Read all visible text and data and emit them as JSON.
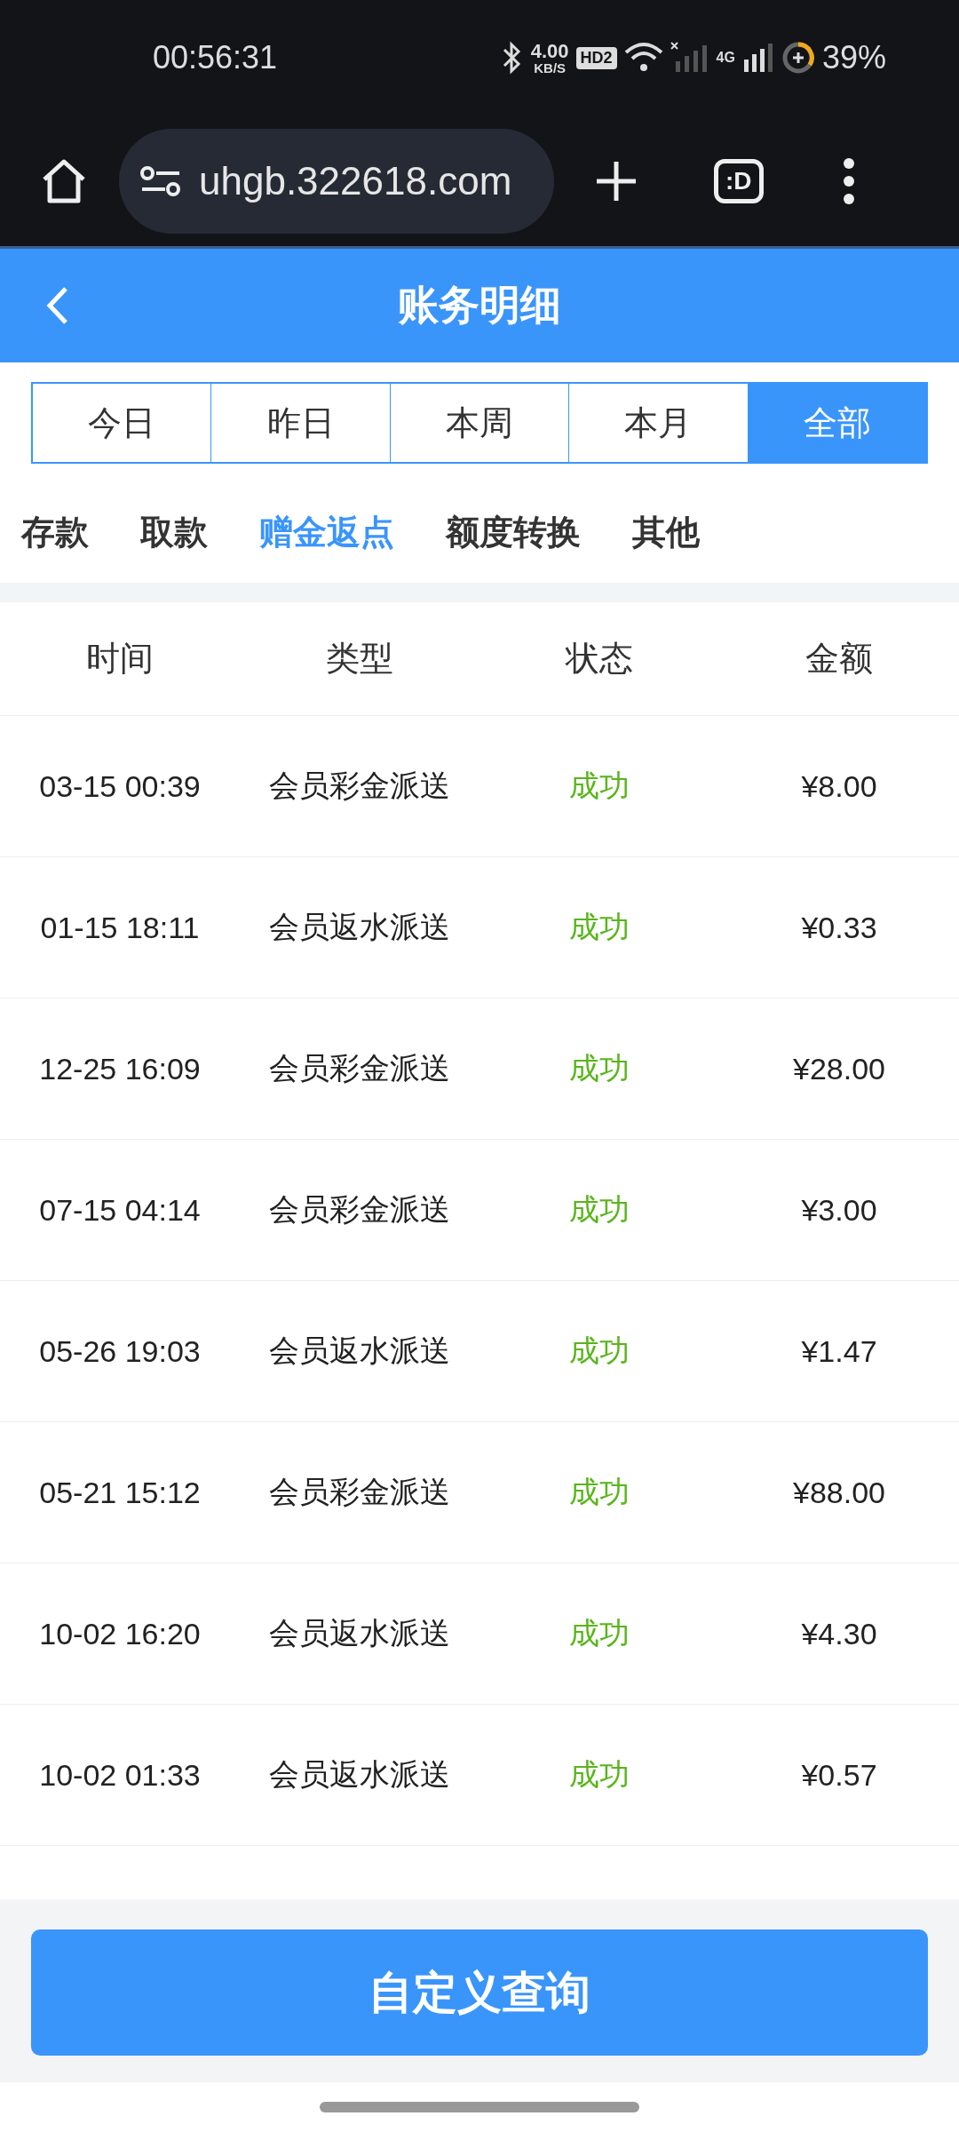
{
  "status_bar": {
    "time": "00:56:31",
    "net_speed": "4.00",
    "net_unit": "KB/S",
    "hd": "HD2",
    "network": "4G",
    "battery": "39%"
  },
  "browser": {
    "url": "uhgb.322618.com",
    "tab_icon": ":D"
  },
  "header": {
    "title": "账务明细"
  },
  "date_tabs": [
    {
      "label": "今日",
      "selected": false
    },
    {
      "label": "昨日",
      "selected": false
    },
    {
      "label": "本周",
      "selected": false
    },
    {
      "label": "本月",
      "selected": false
    },
    {
      "label": "全部",
      "selected": true
    }
  ],
  "category_tabs": [
    {
      "label": "存款",
      "selected": false
    },
    {
      "label": "取款",
      "selected": false
    },
    {
      "label": "赠金返点",
      "selected": true
    },
    {
      "label": "额度转换",
      "selected": false
    },
    {
      "label": "其他",
      "selected": false
    }
  ],
  "table": {
    "columns": [
      "时间",
      "类型",
      "状态",
      "金额"
    ],
    "rows": [
      {
        "time": "03-15 00:39",
        "type": "会员彩金派送",
        "status": "成功",
        "amount": "¥8.00"
      },
      {
        "time": "01-15 18:11",
        "type": "会员返水派送",
        "status": "成功",
        "amount": "¥0.33"
      },
      {
        "time": "12-25 16:09",
        "type": "会员彩金派送",
        "status": "成功",
        "amount": "¥28.00"
      },
      {
        "time": "07-15 04:14",
        "type": "会员彩金派送",
        "status": "成功",
        "amount": "¥3.00"
      },
      {
        "time": "05-26 19:03",
        "type": "会员返水派送",
        "status": "成功",
        "amount": "¥1.47"
      },
      {
        "time": "05-21 15:12",
        "type": "会员彩金派送",
        "status": "成功",
        "amount": "¥88.00"
      },
      {
        "time": "10-02 16:20",
        "type": "会员返水派送",
        "status": "成功",
        "amount": "¥4.30"
      },
      {
        "time": "10-02 01:33",
        "type": "会员返水派送",
        "status": "成功",
        "amount": "¥0.57"
      }
    ]
  },
  "query_button": "自定义查询"
}
